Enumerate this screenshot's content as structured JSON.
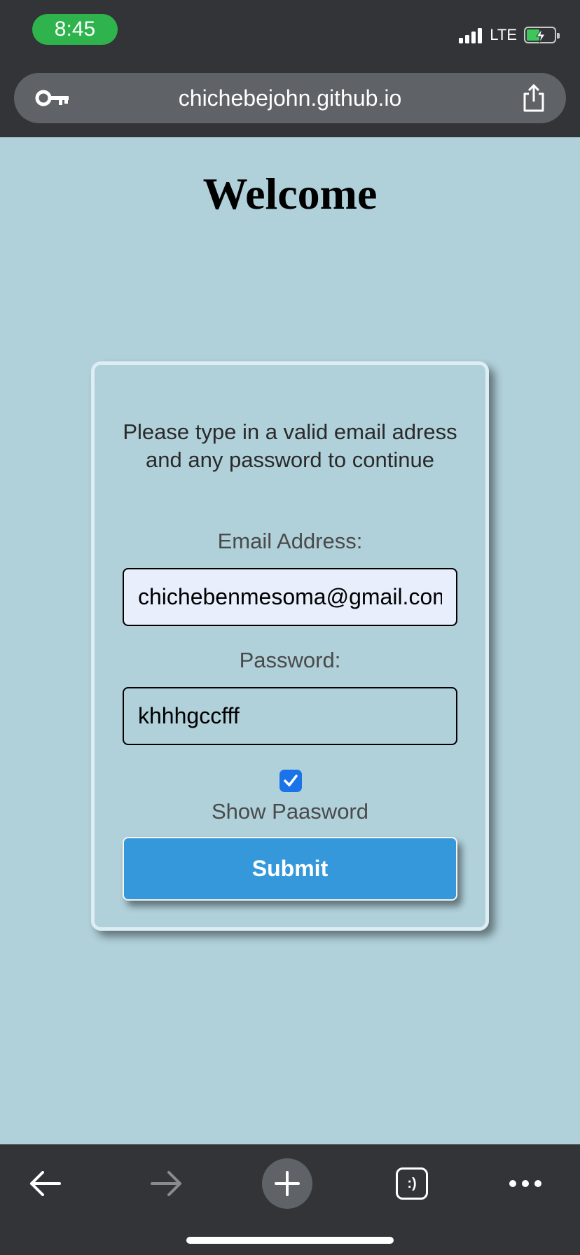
{
  "status_bar": {
    "time": "8:45",
    "network": "LTE"
  },
  "browser": {
    "url": "chichebejohn.github.io"
  },
  "page": {
    "title": "Welcome",
    "message": "Please type in a valid email adress and any password to continue",
    "email_label": "Email Address:",
    "email_value": "chichebenmesoma@gmail.com",
    "password_label": "Password:",
    "password_value": "khhhgccfff",
    "show_password_label": "Show Paasword",
    "show_password_checked": true,
    "submit_label": "Submit"
  },
  "toolbar": {
    "tabs_label": ":)",
    "icons": [
      "back-arrow-icon",
      "forward-arrow-icon",
      "new-tab-plus-icon",
      "tabs-icon",
      "more-icon"
    ]
  },
  "colors": {
    "page_background": "#b0d0da",
    "submit_button": "#3498db",
    "checkbox_accent": "#1a73e8",
    "time_pill": "#2fb34d",
    "chrome": "#323438"
  }
}
